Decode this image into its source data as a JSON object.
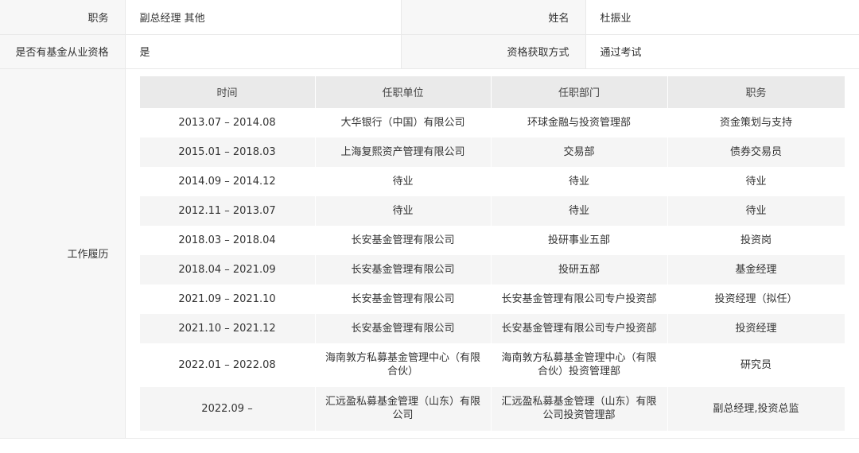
{
  "profile": {
    "position_label": "职务",
    "position_value": "副总经理 其他",
    "name_label": "姓名",
    "name_value": "杜振业",
    "qualification_label": "是否有基金从业资格",
    "qualification_value": "是",
    "method_label": "资格获取方式",
    "method_value": "通过考试",
    "work_label": "工作履历"
  },
  "work_history": {
    "headers": [
      "时间",
      "任职单位",
      "任职部门",
      "职务"
    ],
    "rows": [
      {
        "time": "2013.07 – 2014.08",
        "company": "大华银行（中国）有限公司",
        "department": "环球金融与投资管理部",
        "title": "资金策划与支持"
      },
      {
        "time": "2015.01 – 2018.03",
        "company": "上海复熙资产管理有限公司",
        "department": "交易部",
        "title": "债券交易员"
      },
      {
        "time": "2014.09 – 2014.12",
        "company": "待业",
        "department": "待业",
        "title": "待业"
      },
      {
        "time": "2012.11 – 2013.07",
        "company": "待业",
        "department": "待业",
        "title": "待业"
      },
      {
        "time": "2018.03 – 2018.04",
        "company": "长安基金管理有限公司",
        "department": "投研事业五部",
        "title": "投资岗"
      },
      {
        "time": "2018.04 – 2021.09",
        "company": "长安基金管理有限公司",
        "department": "投研五部",
        "title": "基金经理"
      },
      {
        "time": "2021.09 – 2021.10",
        "company": "长安基金管理有限公司",
        "department": "长安基金管理有限公司专户投资部",
        "title": "投资经理（拟任）"
      },
      {
        "time": "2021.10 – 2021.12",
        "company": "长安基金管理有限公司",
        "department": "长安基金管理有限公司专户投资部",
        "title": "投资经理"
      },
      {
        "time": "2022.01 – 2022.08",
        "company": "海南敦方私募基金管理中心（有限合伙）",
        "department": "海南敦方私募基金管理中心（有限合伙）投资管理部",
        "title": "研究员"
      },
      {
        "time": "2022.09 –",
        "company": "汇远盈私募基金管理（山东）有限公司",
        "department": "汇远盈私募基金管理（山东）有限公司投资管理部",
        "title": "副总经理,投资总监"
      }
    ]
  }
}
